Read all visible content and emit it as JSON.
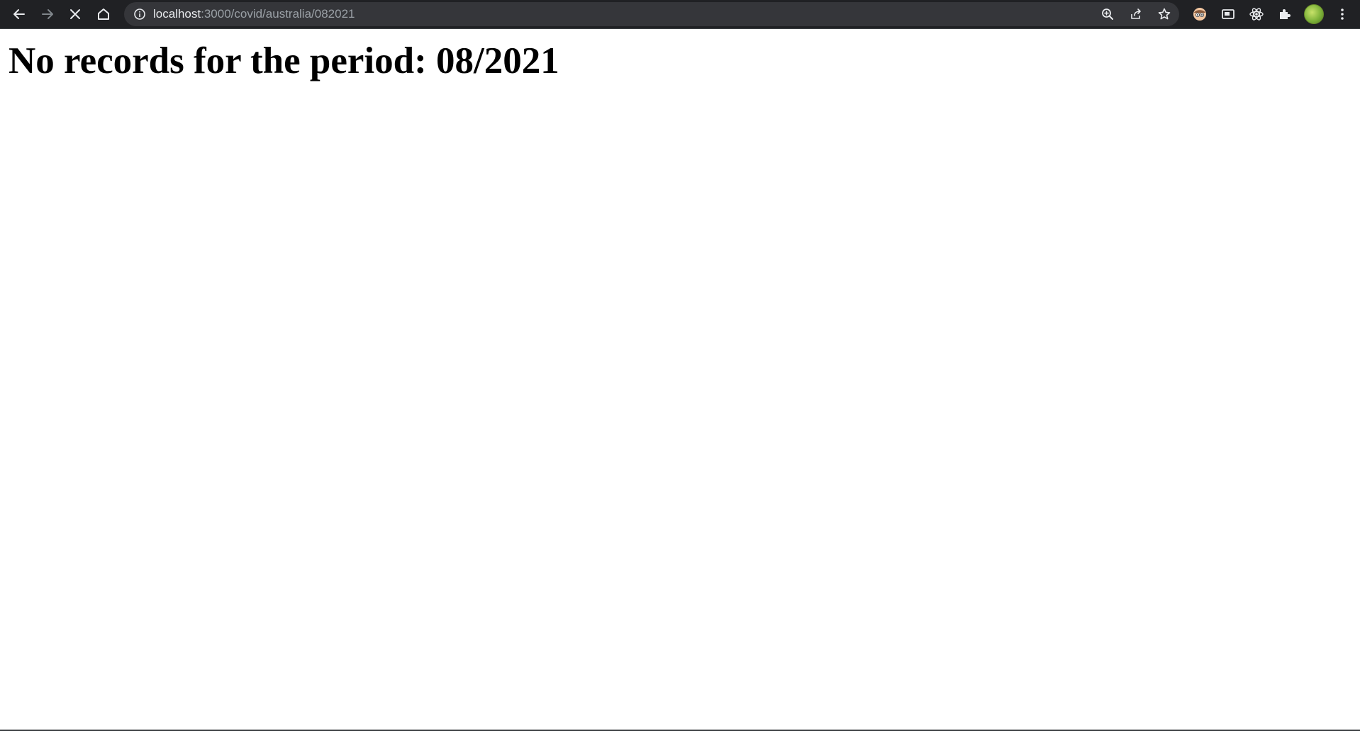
{
  "browser": {
    "url_host": "localhost",
    "url_path": ":3000/covid/australia/082021",
    "icons": {
      "back": "arrow-left-icon",
      "forward": "arrow-right-icon",
      "stop": "close-icon",
      "home": "home-icon",
      "site_info": "info-icon",
      "zoom": "zoom-icon",
      "share": "share-icon",
      "bookmark": "star-icon",
      "extension_1": "extension-face-icon",
      "extension_2": "picture-in-picture-icon",
      "extension_3": "react-devtools-icon",
      "extensions": "puzzle-icon",
      "profile": "avatar",
      "menu": "kebab-menu-icon"
    },
    "colors": {
      "toolbar_bg": "#202124",
      "omnibox_bg": "#35363a",
      "url_host": "#e8eaed",
      "url_path": "#9aa0a6"
    }
  },
  "page": {
    "message": "No records for the period: 08/2021"
  }
}
